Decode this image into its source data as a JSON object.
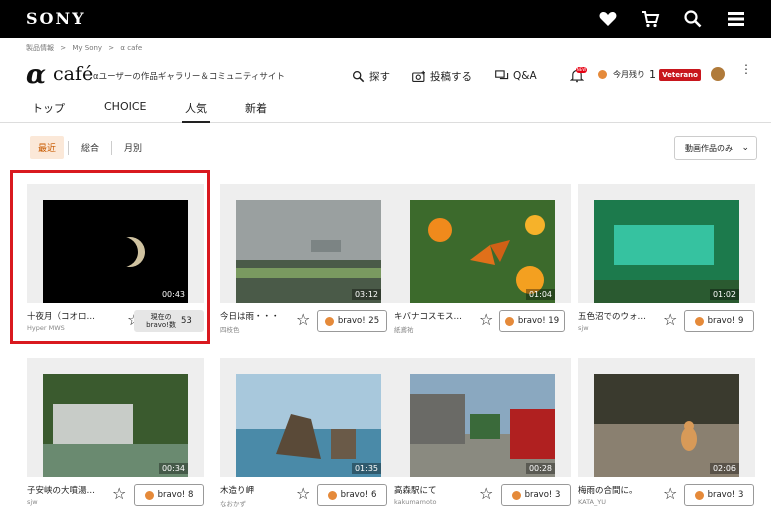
{
  "header": {
    "logo": "SONY"
  },
  "breadcrumb": [
    "製品情報",
    ">",
    "My Sony",
    ">",
    "α cafe"
  ],
  "brand": {
    "alpha": "α",
    "cafe": "café",
    "tagline": "αユーザーの作品ギャラリー＆コミュニティサイト"
  },
  "nav": {
    "search": "探す",
    "post": "投稿する",
    "qa": "Q&A",
    "new_badge": "NEW",
    "remaining_label": "今月残り",
    "remaining_count": "1",
    "rank": "Veterano"
  },
  "tabs": [
    "トップ",
    "CHOICE",
    "人気",
    "新着"
  ],
  "subtabs": [
    "最近",
    "総合",
    "月別"
  ],
  "filter": {
    "label": "動画作品のみ"
  },
  "cards": [
    {
      "title": "十夜月（コオロ…",
      "author": "Hyper MWS",
      "duration": "00:43",
      "bravo_label_line1": "現在の",
      "bravo_label_line2": "bravo!数",
      "bravo_count": "53",
      "bravo": ""
    },
    {
      "title": "今日は雨・・・",
      "author": "四枝色",
      "duration": "03:12",
      "bravo": "bravo! 25"
    },
    {
      "title": "キバナコスモス…",
      "author": "紙鳶祐",
      "duration": "01:04",
      "bravo": "bravo! 19"
    },
    {
      "title": "五色沼でのウォ…",
      "author": "sjw",
      "duration": "01:02",
      "bravo": "bravo! 9"
    },
    {
      "title": "子安峡の大噴湯…",
      "author": "sjw",
      "duration": "00:34",
      "bravo": "bravo! 8"
    },
    {
      "title": "木造り岬",
      "author": "なおかず",
      "duration": "01:35",
      "bravo": "bravo! 6"
    },
    {
      "title": "高森駅にて",
      "author": "kakumamoto",
      "duration": "00:28",
      "bravo": "bravo! 3"
    },
    {
      "title": "梅雨の合間に。",
      "author": "KATA_YU",
      "duration": "02:06",
      "bravo": "bravo! 3"
    }
  ],
  "colors": {
    "accent_red": "#d9191f",
    "veterano_red": "#c8161d",
    "subtab_active_bg": "#fbe8d8"
  }
}
